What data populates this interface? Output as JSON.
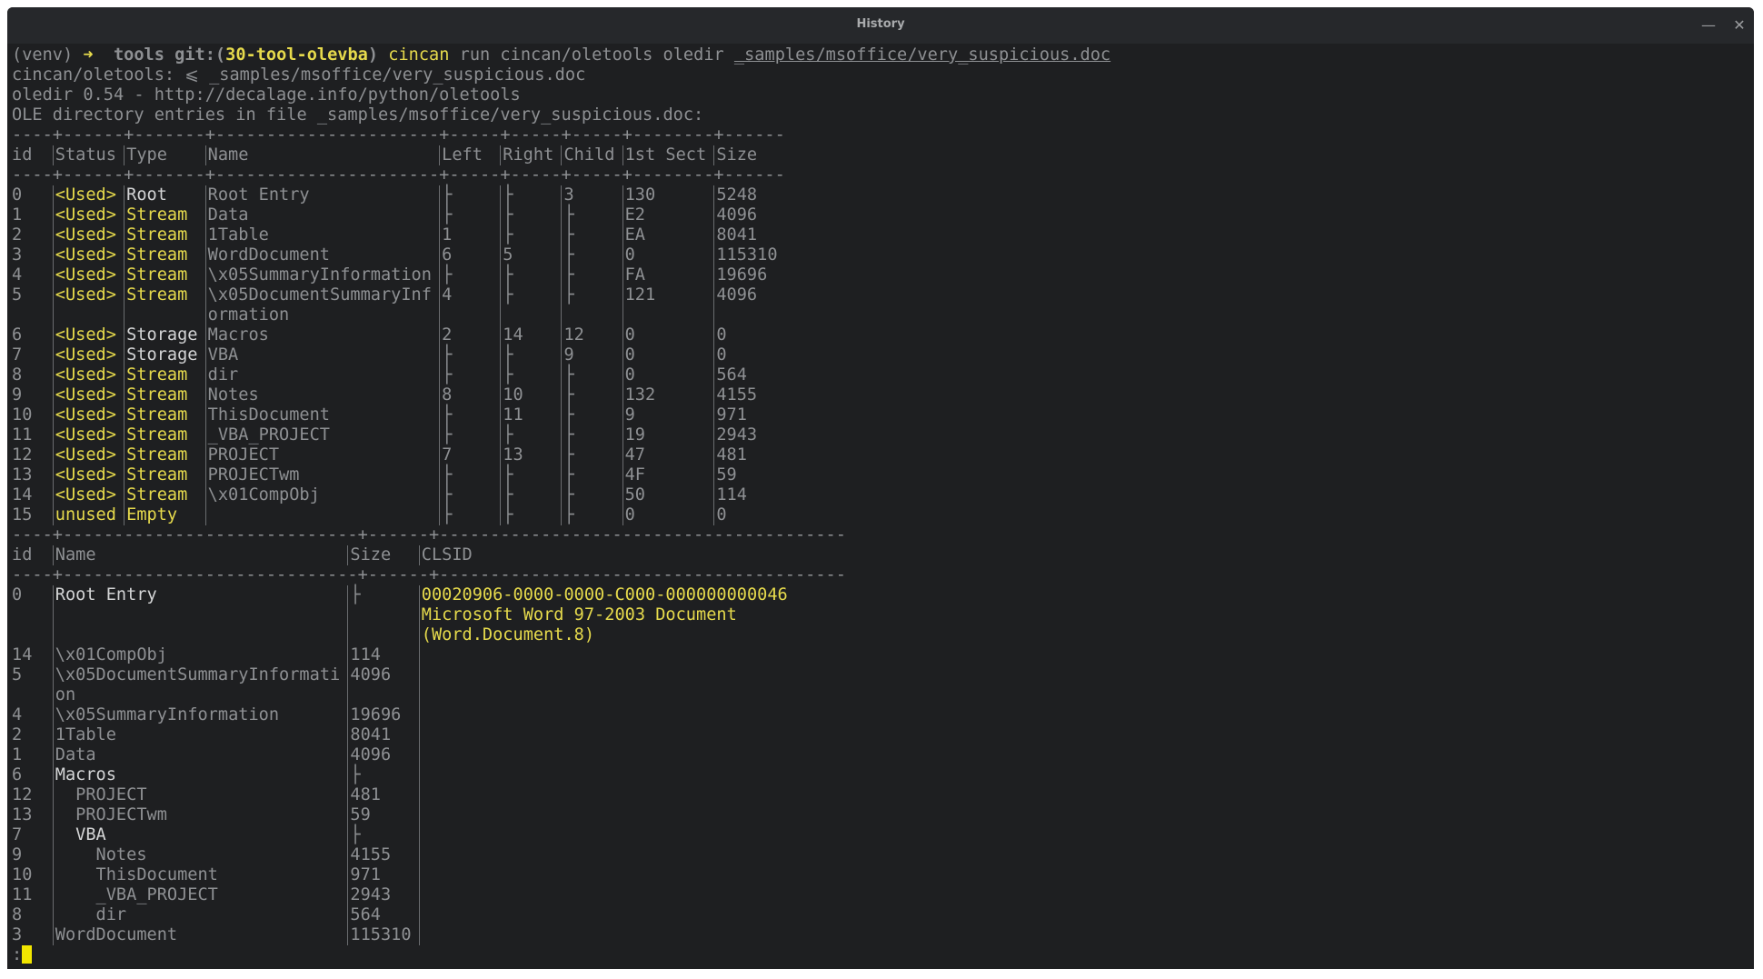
{
  "window": {
    "title": "History",
    "minimize_icon": "minimize-icon",
    "close_icon": "close-icon"
  },
  "colors": {
    "background": "#1e1f21",
    "titlebar": "#26282b",
    "text": "#8e9093",
    "bright": "#d4d5d6",
    "highlight": "#e6da4c",
    "cursor": "#f2e600"
  },
  "prompt": {
    "venv": "(venv)",
    "arrow": "➜",
    "dir": "tools",
    "git_open": "git:(",
    "branch": "30-tool-olevba",
    "git_close": ")",
    "command": "cincan",
    "args": "run cincan/oletools oledir",
    "file": "_samples/msoffice/very_suspicious.doc"
  },
  "output_lines": [
    "cincan/oletools: ⩽ _samples/msoffice/very_suspicious.doc",
    "oledir 0.54 - http://decalage.info/python/oletools",
    "OLE directory entries in file _samples/msoffice/very_suspicious.doc:"
  ],
  "table1": {
    "rule": "----+------+-------+----------------------+-----+-----+-----+--------+------",
    "headers": [
      "id",
      "Status",
      "Type",
      "Name",
      "Left",
      "Right",
      "Child",
      "1st Sect",
      "Size"
    ],
    "rows": [
      [
        "0",
        "<Used>",
        "Root",
        "Root Entry",
        "├",
        "├",
        "3",
        "130",
        "5248"
      ],
      [
        "1",
        "<Used>",
        "Stream",
        "Data",
        "├",
        "├",
        "├",
        "E2",
        "4096"
      ],
      [
        "2",
        "<Used>",
        "Stream",
        "1Table",
        "1",
        "├",
        "├",
        "EA",
        "8041"
      ],
      [
        "3",
        "<Used>",
        "Stream",
        "WordDocument",
        "6",
        "5",
        "├",
        "0",
        "115310"
      ],
      [
        "4",
        "<Used>",
        "Stream",
        "\\x05SummaryInformation",
        "├",
        "├",
        "├",
        "FA",
        "19696"
      ],
      [
        "5",
        "<Used>",
        "Stream",
        "\\x05DocumentSummaryInformation",
        "4",
        "├",
        "├",
        "121",
        "4096"
      ],
      [
        "6",
        "<Used>",
        "Storage",
        "Macros",
        "2",
        "14",
        "12",
        "0",
        "0"
      ],
      [
        "7",
        "<Used>",
        "Storage",
        "VBA",
        "├",
        "├",
        "9",
        "0",
        "0"
      ],
      [
        "8",
        "<Used>",
        "Stream",
        "dir",
        "├",
        "├",
        "├",
        "0",
        "564"
      ],
      [
        "9",
        "<Used>",
        "Stream",
        "Notes",
        "8",
        "10",
        "├",
        "132",
        "4155"
      ],
      [
        "10",
        "<Used>",
        "Stream",
        "ThisDocument",
        "├",
        "11",
        "├",
        "9",
        "971"
      ],
      [
        "11",
        "<Used>",
        "Stream",
        "_VBA_PROJECT",
        "├",
        "├",
        "├",
        "19",
        "2943"
      ],
      [
        "12",
        "<Used>",
        "Stream",
        "PROJECT",
        "7",
        "13",
        "├",
        "47",
        "481"
      ],
      [
        "13",
        "<Used>",
        "Stream",
        "PROJECTwm",
        "├",
        "├",
        "├",
        "4F",
        "59"
      ],
      [
        "14",
        "<Used>",
        "Stream",
        "\\x01CompObj",
        "├",
        "├",
        "├",
        "50",
        "114"
      ],
      [
        "15",
        "unused",
        "Empty",
        "",
        "├",
        "├",
        "├",
        "0",
        "0"
      ]
    ]
  },
  "table2": {
    "rule": "----+-----------------------------+------+----------------------------------------",
    "headers": [
      "id",
      "Name",
      "Size",
      "CLSID"
    ],
    "rows": [
      {
        "id": "0",
        "name": "Root Entry",
        "size": "├",
        "clsid": [
          "00020906-0000-0000-C000-000000000046",
          "Microsoft Word 97-2003 Document",
          "(Word.Document.8)"
        ],
        "emphasis": true
      },
      {
        "id": "14",
        "name": "\\x01CompObj",
        "size": "114",
        "clsid": []
      },
      {
        "id": "5",
        "name": "\\x05DocumentSummaryInformation",
        "size": "4096",
        "clsid": []
      },
      {
        "id": "4",
        "name": "\\x05SummaryInformation",
        "size": "19696",
        "clsid": []
      },
      {
        "id": "2",
        "name": "1Table",
        "size": "8041",
        "clsid": []
      },
      {
        "id": "1",
        "name": "Data",
        "size": "4096",
        "clsid": []
      },
      {
        "id": "6",
        "name": "Macros",
        "size": "├",
        "clsid": [],
        "emphasis": true
      },
      {
        "id": "12",
        "name": "  PROJECT",
        "size": "481",
        "clsid": []
      },
      {
        "id": "13",
        "name": "  PROJECTwm",
        "size": "59",
        "clsid": []
      },
      {
        "id": "7",
        "name": "  VBA",
        "size": "├",
        "clsid": [],
        "emphasis": true
      },
      {
        "id": "9",
        "name": "    Notes",
        "size": "4155",
        "clsid": []
      },
      {
        "id": "10",
        "name": "    ThisDocument",
        "size": "971",
        "clsid": []
      },
      {
        "id": "11",
        "name": "    _VBA_PROJECT",
        "size": "2943",
        "clsid": []
      },
      {
        "id": "8",
        "name": "    dir",
        "size": "564",
        "clsid": []
      },
      {
        "id": "3",
        "name": "WordDocument",
        "size": "115310",
        "clsid": []
      }
    ]
  },
  "pager_prompt": ":"
}
